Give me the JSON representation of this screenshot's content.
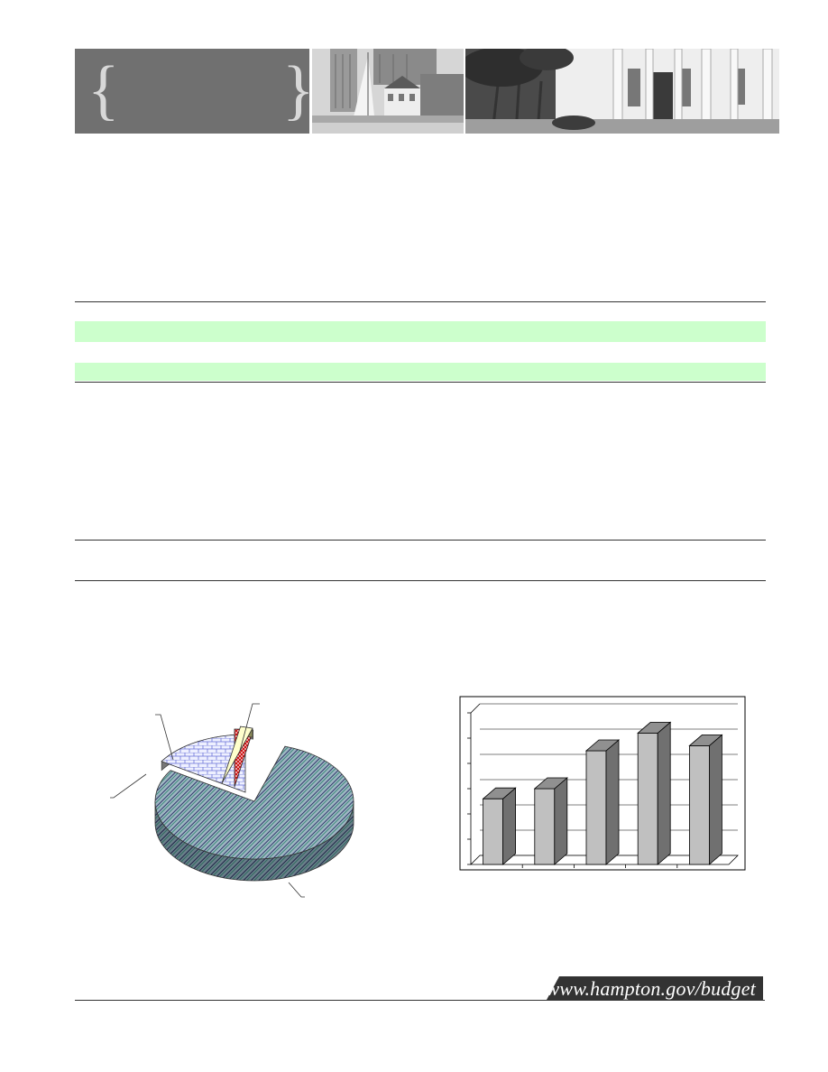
{
  "header": {
    "banner_icon": "curly-brace-icon",
    "photo_left_subject": "waterfront marina with sailboat",
    "photo_right_subject": "historic court house facade"
  },
  "footer": {
    "url": "www.hampton.gov/budget"
  },
  "pie_chart": {
    "type": "pie",
    "slices": [
      {
        "value": 79,
        "fill": "#8fa8b8",
        "pattern": "diagonal-stripes"
      },
      {
        "value": 16,
        "fill": "#e8ecff",
        "pattern": "brick"
      },
      {
        "value": 3,
        "fill": "#cc2222",
        "pattern": "crosshatch"
      },
      {
        "value": 2,
        "fill": "#ffffcc",
        "pattern": "solid"
      }
    ]
  },
  "chart_data": {
    "type": "bar",
    "categories": [
      "",
      "",
      "",
      "",
      ""
    ],
    "values": [
      2.6,
      3.0,
      4.5,
      5.2,
      4.7
    ],
    "ylim": [
      0,
      6
    ],
    "grid": true,
    "bar_color": "#c0c0c0",
    "side_color": "#707070",
    "top_color": "#909090"
  }
}
